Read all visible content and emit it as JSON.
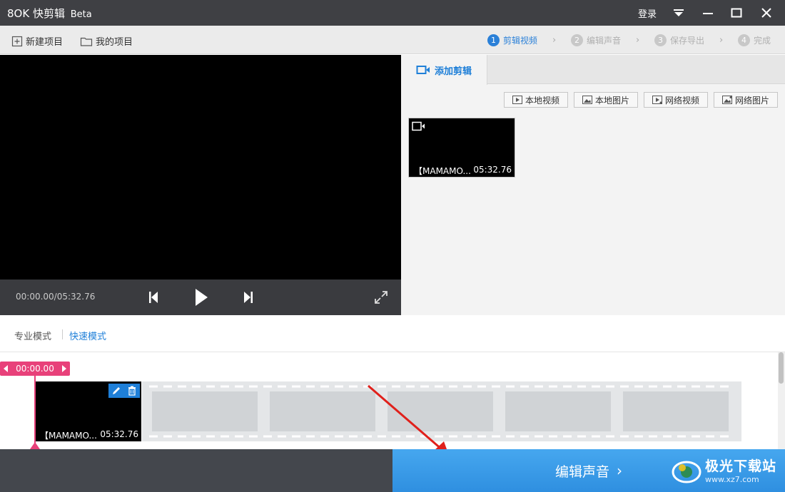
{
  "app": {
    "logo_text": "8OK",
    "name": "快剪辑",
    "beta": "Beta",
    "login": "登录"
  },
  "toolbar": {
    "new_project": "新建项目",
    "my_projects": "我的项目",
    "steps": [
      {
        "num": "1",
        "label": "剪辑视频",
        "active": true
      },
      {
        "num": "2",
        "label": "编辑声音",
        "active": false
      },
      {
        "num": "3",
        "label": "保存导出",
        "active": false
      },
      {
        "num": "4",
        "label": "完成",
        "active": false
      }
    ]
  },
  "player": {
    "timecode": "00:00.00/05:32.76"
  },
  "library": {
    "tab_label": "添加剪辑",
    "sources": [
      "本地视频",
      "本地图片",
      "网络视频",
      "网络图片"
    ],
    "clips": [
      {
        "name": "【MAMAMO...",
        "duration": "05:32.76"
      }
    ]
  },
  "modes": {
    "pro": "专业模式",
    "fast": "快速模式"
  },
  "timeline": {
    "playhead_time": "00:00.00",
    "clip_name": "【MAMAMO...",
    "clip_duration": "05:32.76"
  },
  "footer": {
    "next_label": "编辑声音",
    "watermark_text": "极光下载站",
    "watermark_url": "www.xz7.com"
  },
  "colors": {
    "accent": "#2a80d8",
    "playhead": "#e8417a",
    "next_button": "#3a9ae8",
    "titlebar": "#3f4044"
  }
}
